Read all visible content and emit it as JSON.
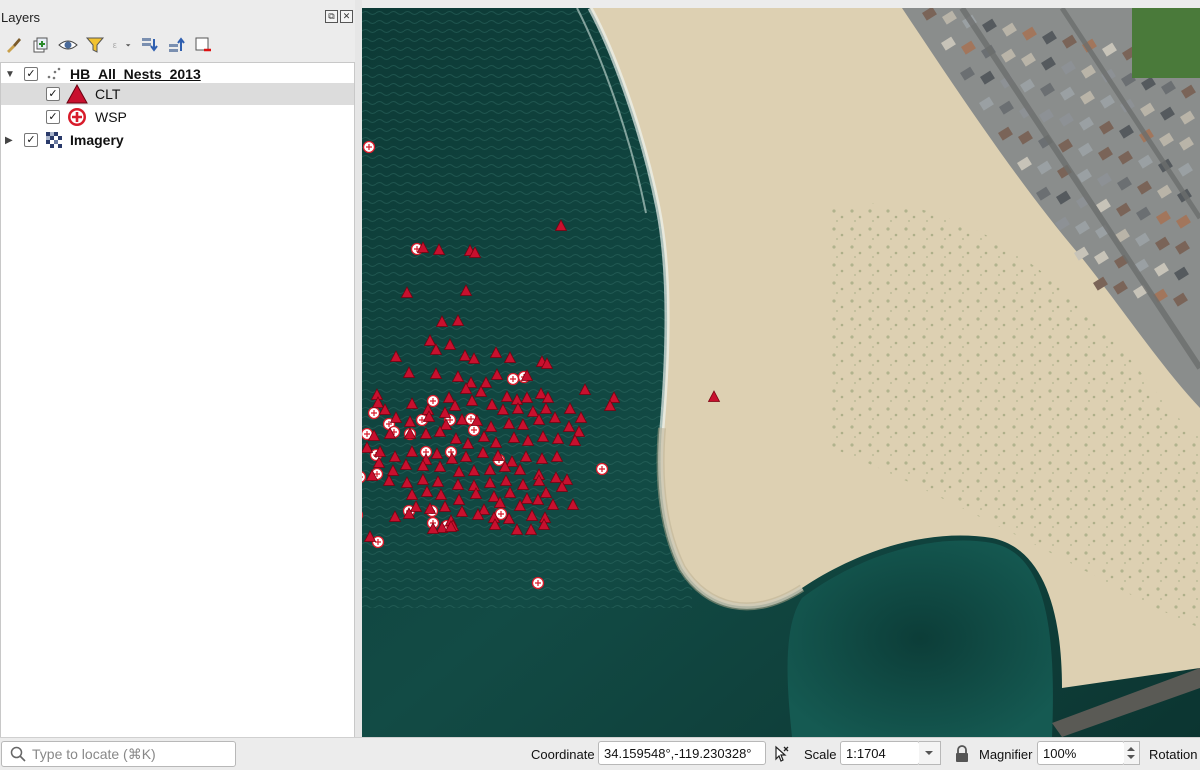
{
  "panel": {
    "title": "Layers",
    "float_symbol": "⧉",
    "close_symbol": "✕"
  },
  "toolbar": {
    "icons": [
      "paintbrush-icon",
      "add-group-icon",
      "eye-icon",
      "filter-icon",
      "expression-filter-icon",
      "expand-all-icon",
      "collapse-all-icon",
      "remove-layer-icon"
    ]
  },
  "tree": {
    "nest_layer": {
      "label": "HB_All_Nests_2013",
      "checked": "✓",
      "expander": "▼"
    },
    "clt": {
      "label": "CLT",
      "checked": "✓"
    },
    "wsp": {
      "label": "WSP",
      "checked": "✓"
    },
    "imagery": {
      "label": "Imagery",
      "checked": "✓",
      "expander": "▶"
    }
  },
  "statusbar": {
    "locate_placeholder": "Type to locate (⌘K)",
    "coordinate_label": "Coordinate",
    "coordinate_value": "34.159548°,-119.230328°",
    "scale_label": "Scale",
    "scale_value": "1:1704",
    "magnifier_label": "Magnifier",
    "magnifier_value": "100%",
    "rotation_label": "Rotation"
  },
  "colors": {
    "clt_fill": "#c8102e",
    "wsp_fill": "#d81b2a",
    "sand": "#ddd0b2",
    "water": "#0f4540"
  }
}
